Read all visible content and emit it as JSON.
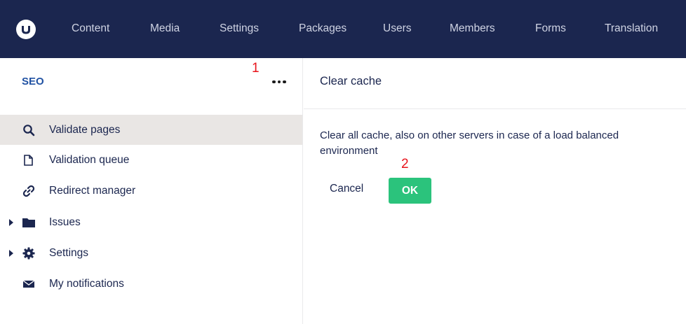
{
  "nav": {
    "logo_icon": "umbraco-logo-icon",
    "items": [
      "Content",
      "Media",
      "Settings",
      "Packages",
      "Users",
      "Members",
      "Forms",
      "Translation"
    ]
  },
  "sidebar": {
    "title": "SEO",
    "marker_1": "1",
    "more_icon": "ellipsis-icon",
    "items": [
      {
        "label": "Validate pages",
        "icon": "search-icon",
        "active": true,
        "expandable": false
      },
      {
        "label": "Validation queue",
        "icon": "document-icon",
        "active": false,
        "expandable": false
      },
      {
        "label": "Redirect manager",
        "icon": "link-icon",
        "active": false,
        "expandable": false
      },
      {
        "label": "Issues",
        "icon": "folder-icon",
        "active": false,
        "expandable": true
      },
      {
        "label": "Settings",
        "icon": "gear-icon",
        "active": false,
        "expandable": true
      },
      {
        "label": "My notifications",
        "icon": "envelope-icon",
        "active": false,
        "expandable": false
      }
    ]
  },
  "main": {
    "title": "Clear cache",
    "description": "Clear all cache, also on other servers in case of a load balanced environment",
    "marker_2": "2",
    "cancel_label": "Cancel",
    "ok_label": "OK"
  },
  "colors": {
    "topbar": "#1b264f",
    "accent_green": "#2bc37c",
    "section_title": "#2152a3",
    "marker_red": "#e8141b",
    "active_row": "#e9e6e4"
  }
}
